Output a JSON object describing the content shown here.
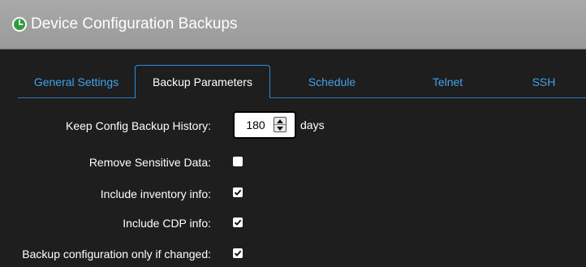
{
  "window": {
    "title": "Device Configuration Backups",
    "icon": "clock-icon",
    "accent": "#3fa3ea"
  },
  "tabs": [
    {
      "label": "General Settings",
      "active": false
    },
    {
      "label": "Backup Parameters",
      "active": true
    },
    {
      "label": "Schedule",
      "active": false
    },
    {
      "label": "Telnet",
      "active": false
    },
    {
      "label": "SSH",
      "active": false
    }
  ],
  "form": {
    "history": {
      "label": "Keep Config Backup History:",
      "value": "180",
      "unit": "days"
    },
    "remove_sensitive": {
      "label": "Remove Sensitive Data:",
      "checked": false
    },
    "include_inventory": {
      "label": "Include inventory info:",
      "checked": true
    },
    "include_cdp": {
      "label": "Include CDP info:",
      "checked": true
    },
    "backup_if_changed": {
      "label": "Backup configuration only if changed:",
      "checked": true
    }
  }
}
